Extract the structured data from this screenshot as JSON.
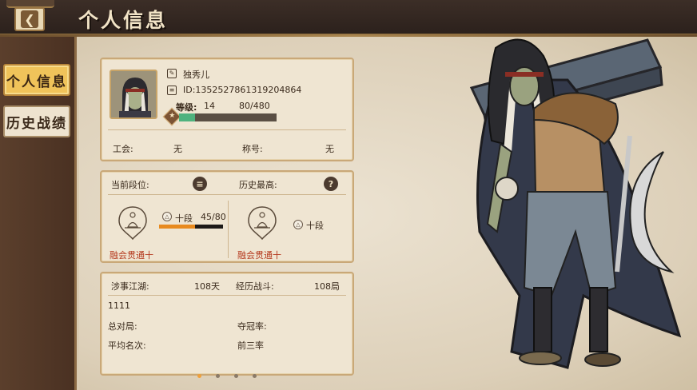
{
  "header": {
    "title": "个人信息"
  },
  "sidebar": {
    "tabs": [
      {
        "label": "个人信息",
        "active": true
      },
      {
        "label": "历史战绩",
        "active": false
      }
    ]
  },
  "profile": {
    "name": "独秀儿",
    "id": "ID:1352527861319204864",
    "level_label": "等级:",
    "level": "14",
    "exp": "80/480",
    "exp_fraction": 0.167,
    "guild_label": "工会:",
    "guild_value": "无",
    "title_label": "称号:",
    "title_value": "无"
  },
  "rank": {
    "current_label": "当前段位:",
    "history_label": "历史最高:",
    "current": {
      "tier": "十段",
      "progress": "45/80",
      "progress_fraction": 0.5625,
      "realm": "融会贯通十"
    },
    "best": {
      "tier": "十段",
      "realm": "融会贯通十"
    }
  },
  "stats": {
    "days_label": "涉事江湖:",
    "days_value": "108天",
    "battles_label": "经历战斗:",
    "battles_value": "108局",
    "note": "1111",
    "total_label": "总对局:",
    "win_rate_label": "夺冠率:",
    "avg_rank_label": "平均名次:",
    "top3_label": "前三率"
  },
  "pagination": {
    "pages": 4,
    "current": 1
  },
  "colors": {
    "accent_gold": "#f0c35a",
    "exp_green": "#4fb27e",
    "rank_orange": "#e88a1e",
    "realm_red": "#b53a1f"
  },
  "icons": [
    "back-arrow-icon",
    "edit-icon",
    "id-card-icon",
    "level-star-icon",
    "list-icon",
    "help-icon",
    "meditation-rank-icon"
  ]
}
